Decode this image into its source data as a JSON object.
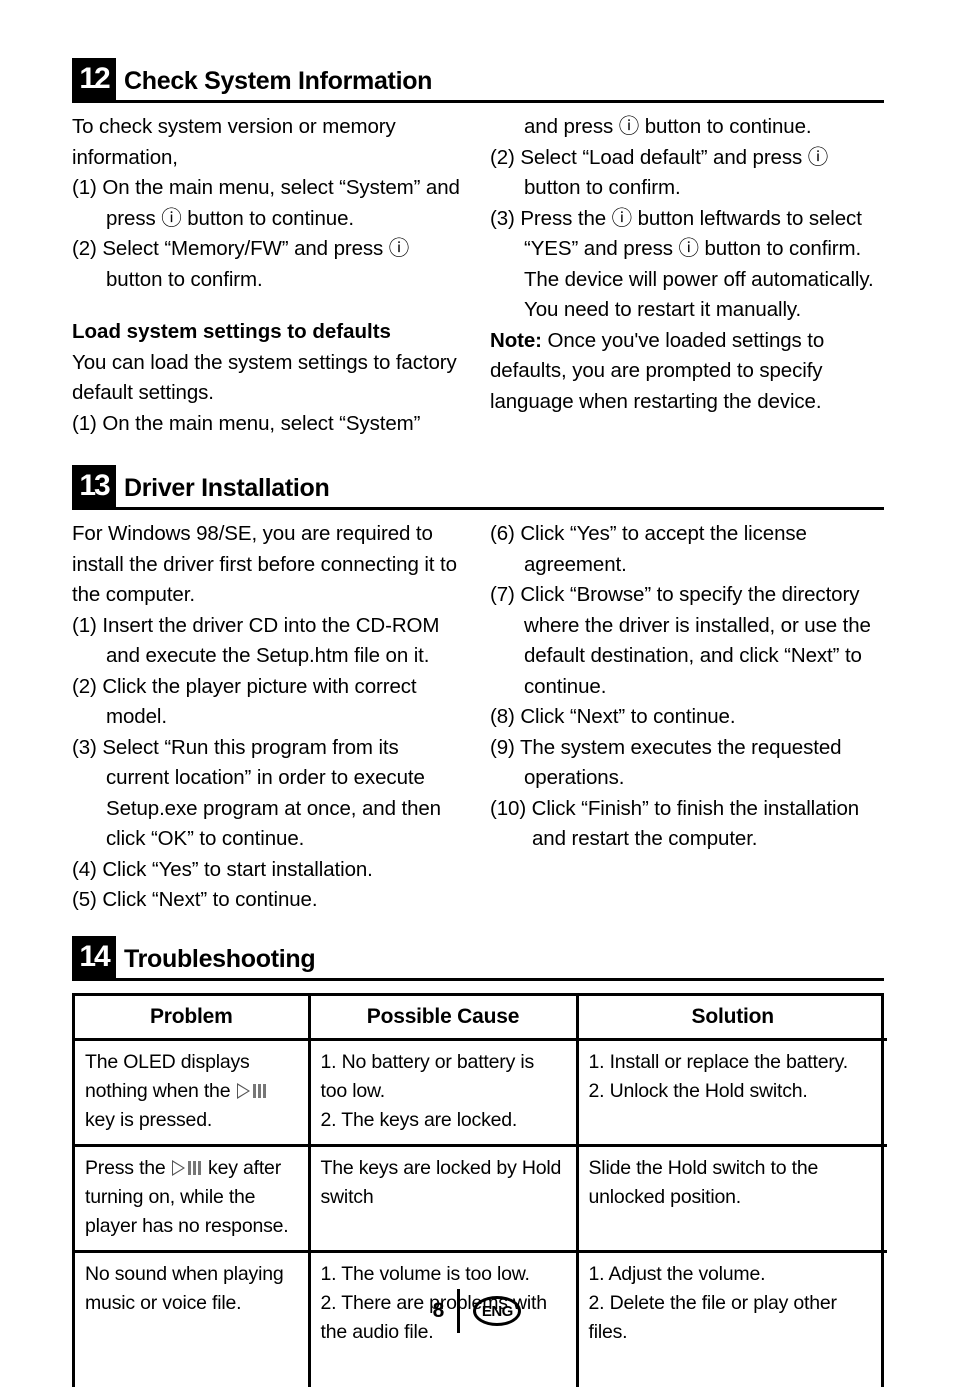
{
  "document": {
    "page_number": "8",
    "language_badge": "ENG"
  },
  "sections": [
    {
      "number": "12",
      "title": "Check System Information",
      "left_column": {
        "intro": "To check system version or memory information,",
        "steps": [
          "(1) On the main menu, select “System” and press ⓘ button to continue.",
          "(2) Select “Memory/FW” and press ⓘ button to confirm."
        ],
        "sub_heading": "Load system settings to defaults",
        "sub_intro": "You can load the system settings to factory default settings.",
        "sub_steps": [
          "(1) On the main menu, select “System”"
        ]
      },
      "right_column": {
        "continuation": "and press ⓘ button to continue.",
        "steps": [
          "(2) Select “Load default” and press ⓘ button to confirm.",
          "(3) Press the ⓘ button leftwards to select “YES” and press ⓘ button to confirm. The device will power off automatically. You need to restart it manually."
        ],
        "note_label": "Note:",
        "note_text": " Once you've loaded settings to defaults, you are prompted to specify language when restarting the device."
      }
    },
    {
      "number": "13",
      "title": "Driver Installation",
      "left_column": {
        "intro": "For Windows 98/SE, you are required to install the driver first before connecting it to the computer.",
        "steps": [
          "(1) Insert the driver CD into the CD-ROM and execute the Setup.htm file on it.",
          "(2) Click the player picture with correct model.",
          "(3) Select “Run this program from its current location” in order to execute Setup.exe program at once, and then click “OK” to continue.",
          "(4) Click “Yes” to start installation.",
          "(5) Click “Next” to continue."
        ]
      },
      "right_column": {
        "steps": [
          "(6) Click “Yes” to accept the license agreement.",
          "(7) Click “Browse” to specify the directory where the driver is installed, or use the default destination, and click “Next” to continue.",
          "(8) Click “Next” to continue.",
          "(9) The system executes the requested operations."
        ],
        "steps_wide": [
          "(10) Click “Finish” to finish the installation and restart the computer."
        ]
      }
    },
    {
      "number": "14",
      "title": "Troubleshooting"
    }
  ],
  "troubleshooting_table": {
    "headers": [
      "Problem",
      "Possible Cause",
      "Solution"
    ],
    "rows": [
      {
        "problem_before": "The OLED displays nothing when the ",
        "problem_icon": "play-pause-icon",
        "problem_after": " key is pressed.",
        "cause": "1. No battery or battery is too low.\n2. The keys are locked.",
        "solution": "1. Install or replace the battery.\n2. Unlock the Hold switch."
      },
      {
        "problem_before": "Press the ",
        "problem_icon": "play-pause-icon",
        "problem_after": " key after turning on, while the player has no response.",
        "cause": "The keys are locked by Hold switch",
        "solution": "Slide the Hold switch to the unlocked position."
      },
      {
        "problem_before": "No sound when playing music or voice file.",
        "problem_icon": "",
        "problem_after": "",
        "cause": "1. The volume is too low.\n2. There are problems with the audio file.",
        "solution": "1. Adjust the volume.\n2. Delete the file or play other files."
      }
    ]
  }
}
